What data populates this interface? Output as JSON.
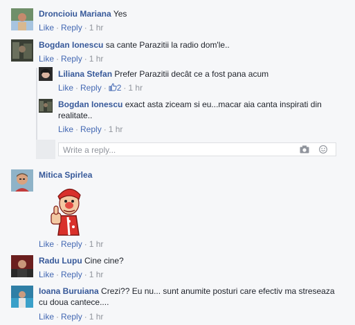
{
  "comments": [
    {
      "author": "Droncioiu Mariana",
      "text": "Yes",
      "like": "Like",
      "reply": "Reply",
      "time": "1 hr"
    },
    {
      "author": "Bogdan Ionescu",
      "text": "sa cante Parazitii la radio dom'le..",
      "like": "Like",
      "reply": "Reply",
      "time": "1 hr",
      "replies": [
        {
          "author": "Liliana Stefan",
          "text": "Prefer Parazitii decât ce a fost pana acum",
          "like": "Like",
          "reply": "Reply",
          "likes_count": "2",
          "time": "1 hr"
        },
        {
          "author": "Bogdan Ionescu",
          "text_line1": "exact asta ziceam si eu...macar aia canta inspirati din",
          "text_line2": "realitate..",
          "like": "Like",
          "reply": "Reply",
          "time": "1 hr"
        }
      ],
      "reply_input": {
        "placeholder": "Write a reply..."
      }
    },
    {
      "author": "Mitica Spirlea",
      "text": "",
      "like": "Like",
      "reply": "Reply",
      "time": "1 hr",
      "sticker": "thumbs-up-mascot-sticker"
    },
    {
      "author": "Radu Lupu",
      "text": "Cine cine?",
      "like": "Like",
      "reply": "Reply",
      "time": "1 hr"
    },
    {
      "author": "Ioana Buruiana",
      "text_line1": "Crezi?? Eu nu... sunt anumite posturi care efectiv ma streseaza",
      "text_line2": "cu doua cantece....",
      "like": "Like",
      "reply": "Reply",
      "time": "1 hr"
    }
  ],
  "icons": {
    "camera": "camera-icon",
    "emoji": "emoji-icon",
    "like_count": "thumbs-up-icon"
  },
  "colors": {
    "author": "#365899",
    "link": "#4267b2",
    "meta": "#90949c",
    "background": "#f6f7f9"
  }
}
